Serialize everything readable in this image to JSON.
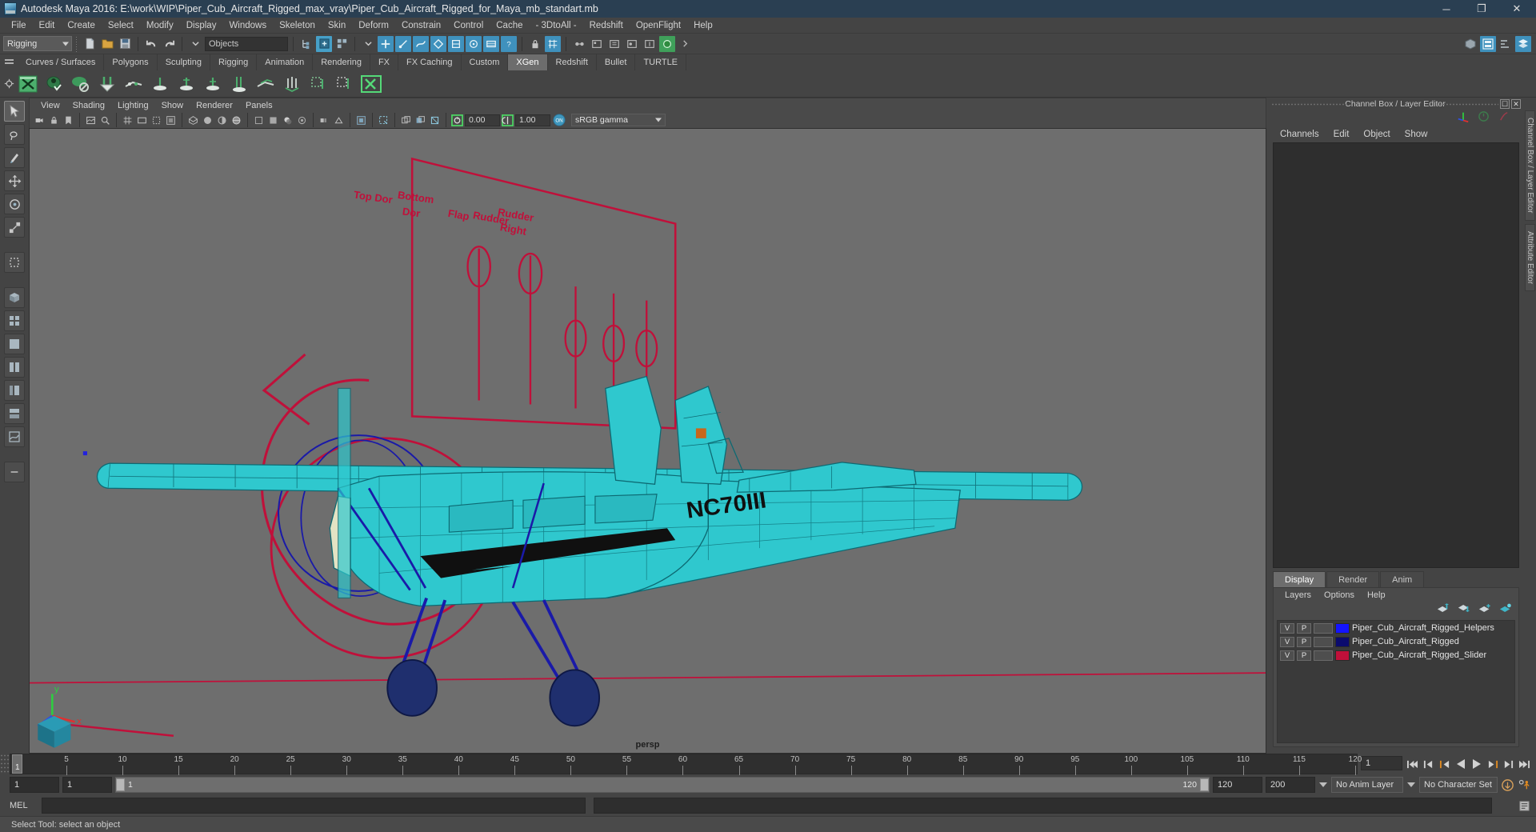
{
  "window": {
    "title": "Autodesk Maya 2016: E:\\work\\WIP\\Piper_Cub_Aircraft_Rigged_max_vray\\Piper_Cub_Aircraft_Rigged_for_Maya_mb_standart.mb",
    "app_icon": "maya-icon",
    "minimize": "─",
    "maximize": "❐",
    "close": "✕"
  },
  "menubar": {
    "items": [
      "File",
      "Edit",
      "Create",
      "Select",
      "Modify",
      "Display",
      "Windows",
      "Skeleton",
      "Skin",
      "Deform",
      "Constrain",
      "Control",
      "Cache",
      "- 3DtoAll -",
      "Redshift",
      "OpenFlight",
      "Help"
    ]
  },
  "statusline": {
    "mode": "Rigging",
    "objects_field": "Objects",
    "objects_placeholder": "Objects"
  },
  "shelf": {
    "tabs": [
      "Curves / Surfaces",
      "Polygons",
      "Sculpting",
      "Rigging",
      "Animation",
      "Rendering",
      "FX",
      "FX Caching",
      "Custom",
      "XGen",
      "Redshift",
      "Bullet",
      "TURTLE"
    ],
    "selected_tab": "XGen"
  },
  "viewport": {
    "menu": [
      "View",
      "Shading",
      "Lighting",
      "Show",
      "Renderer",
      "Panels"
    ],
    "exposure": "0.00",
    "gamma": "1.00",
    "color_management": "sRGB gamma",
    "view_label": "persp",
    "annotations": [
      {
        "label": "Top Dor"
      },
      {
        "label": "Bottom",
        "label2": "Dor"
      },
      {
        "label": "Flap"
      },
      {
        "label": "Rudder"
      },
      {
        "label": "Rudder",
        "label2": "Right"
      }
    ]
  },
  "channelbox": {
    "title": "Channel Box / Layer Editor",
    "menus": [
      "Channels",
      "Edit",
      "Object",
      "Show"
    ]
  },
  "layer_editor": {
    "tabs": [
      "Display",
      "Render",
      "Anim"
    ],
    "selected_tab": "Display",
    "menus": [
      "Layers",
      "Options",
      "Help"
    ],
    "layers": [
      {
        "visibility": "V",
        "playback": "P",
        "color": "#1414ff",
        "name": "Piper_Cub_Aircraft_Rigged_Helpers"
      },
      {
        "visibility": "V",
        "playback": "P",
        "color": "#0b0b6e",
        "name": "Piper_Cub_Aircraft_Rigged"
      },
      {
        "visibility": "V",
        "playback": "P",
        "color": "#c0103a",
        "name": "Piper_Cub_Aircraft_Rigged_Slider"
      }
    ]
  },
  "side_tabs": [
    "Channel Box / Layer Editor",
    "Attribute Editor"
  ],
  "timeline": {
    "start": 1,
    "end": 120,
    "current_frame": "1",
    "ticks": [
      5,
      10,
      15,
      20,
      25,
      30,
      35,
      40,
      45,
      50,
      55,
      60,
      65,
      70,
      75,
      80,
      85,
      90,
      95,
      100,
      105,
      110,
      115,
      120
    ],
    "playback_buttons": [
      "go-to-start",
      "step-back-key",
      "step-back-frame",
      "play-backwards",
      "play-forwards",
      "step-forward-frame",
      "step-forward-key",
      "go-to-end"
    ]
  },
  "range": {
    "anim_start": "1",
    "range_start": "1",
    "slider_min": "1",
    "slider_max": "120",
    "range_end": "120",
    "anim_end": "200",
    "anim_layer": "No Anim Layer",
    "character_set": "No Character Set"
  },
  "command_line": {
    "label": "MEL",
    "value": "",
    "placeholder": ""
  },
  "status_bar": {
    "message": "Select Tool: select an object"
  },
  "colors": {
    "accent_blue": "#46a0c8",
    "aircraft_cyan": "#2fcfd4",
    "wireframe_blue": "#1a1aa8",
    "annotation_red": "#c0103a",
    "title_bar": "#2a3f52"
  }
}
